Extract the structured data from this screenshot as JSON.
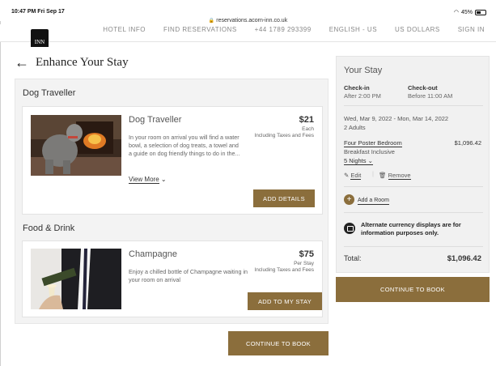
{
  "status_bar": {
    "time": "10:47 PM  Fri Sep 17",
    "url": "reservations.acorn-inn.co.uk",
    "battery": "45%"
  },
  "nav": {
    "logo_text": "INN",
    "items": [
      "HOTEL INFO",
      "FIND RESERVATIONS",
      "+44 1789 293399",
      "ENGLISH - US",
      "US DOLLARS",
      "SIGN IN"
    ]
  },
  "page": {
    "title": "Enhance Your Stay"
  },
  "sections": [
    {
      "title": "Dog Traveller",
      "card": {
        "name": "Dog Traveller",
        "description": "In your room on arrival you will find a water bowl, a selection of dog treats, a towel and a guide on dog friendly things to do in the...",
        "price": "$21",
        "price_unit": "Each",
        "price_note": "Including Taxes and Fees",
        "view_more": "View More",
        "button": "ADD DETAILS"
      }
    },
    {
      "title": "Food & Drink",
      "card": {
        "name": "Champagne",
        "description": "Enjoy a chilled bottle of Champagne waiting in your room on arrival",
        "price": "$75",
        "price_unit": "Per Stay",
        "price_note": "Including Taxes and Fees",
        "button": "ADD TO MY STAY"
      }
    }
  ],
  "continue_button": "CONTINUE TO BOOK",
  "summary": {
    "title": "Your Stay",
    "checkin_label": "Check-in",
    "checkin_value": "After 2:00 PM",
    "checkout_label": "Check-out",
    "checkout_value": "Before 11:00 AM",
    "dates": "Wed, Mar 9, 2022 - Mon, Mar 14, 2022",
    "guests": "2 Adults",
    "room_name": "Four Poster Bedroom",
    "room_price": "$1,096.42",
    "rate": "Breakfast Inclusive",
    "nights": "5 Nights",
    "edit": "Edit",
    "remove": "Remove",
    "add_room": "Add a Room",
    "currency_note": "Alternate currency displays are for information purposes only.",
    "total_label": "Total:",
    "total_value": "$1,096.42",
    "button": "CONTINUE TO BOOK"
  },
  "colors": {
    "accent": "#8b6e3c",
    "panel": "#f3f3f3"
  }
}
